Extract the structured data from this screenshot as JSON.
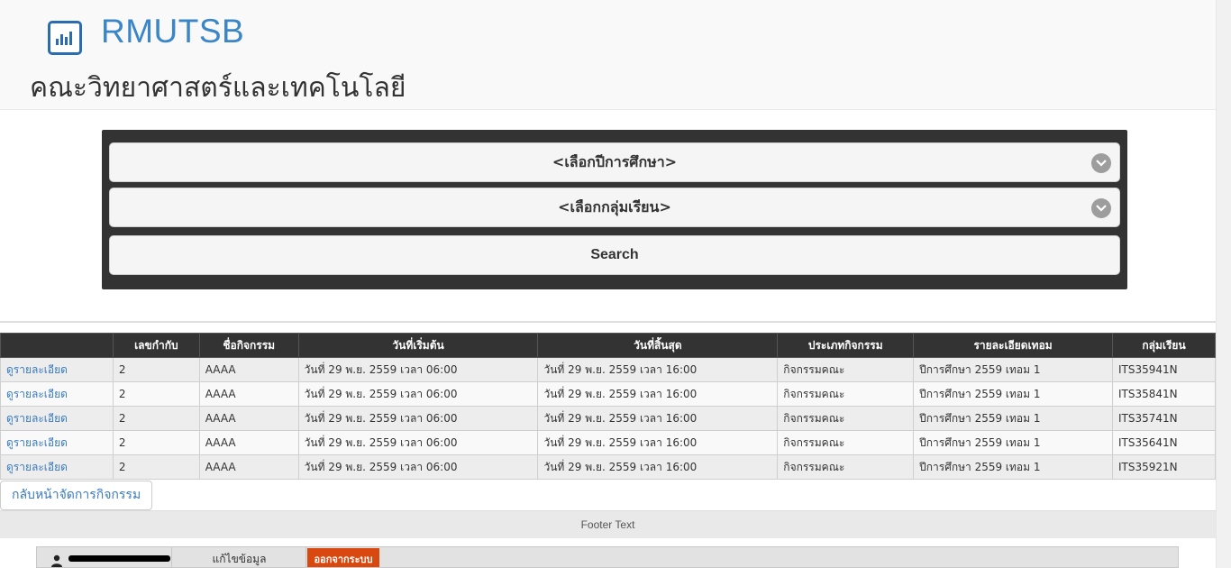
{
  "header": {
    "brand": "RMUTSB",
    "faculty": "คณะวิทยาศาสตร์และเทคโนโลยี",
    "logo_icon": "bar-chart-icon"
  },
  "filters": {
    "year_select": "<เลือกปีการศึกษา>",
    "group_select": "<เลือกกลุ่มเรียน>",
    "search_label": "Search"
  },
  "table": {
    "columns": [
      "",
      "เลขกำกับ",
      "ชื่อกิจกรรม",
      "วันที่เริ่มต้น",
      "วันที่สิ้นสุด",
      "ประเภทกิจกรรม",
      "รายละเอียดเทอม",
      "กลุ่มเรียน"
    ],
    "rows": [
      [
        "ดูรายละเอียด",
        "2",
        "AAAA",
        "วันที่ 29 พ.ย. 2559 เวลา 06:00",
        "วันที่ 29 พ.ย. 2559 เวลา 16:00",
        "กิจกรรมคณะ",
        "ปีการศึกษา 2559 เทอม 1",
        "ITS35941N"
      ],
      [
        "ดูรายละเอียด",
        "2",
        "AAAA",
        "วันที่ 29 พ.ย. 2559 เวลา 06:00",
        "วันที่ 29 พ.ย. 2559 เวลา 16:00",
        "กิจกรรมคณะ",
        "ปีการศึกษา 2559 เทอม 1",
        "ITS35841N"
      ],
      [
        "ดูรายละเอียด",
        "2",
        "AAAA",
        "วันที่ 29 พ.ย. 2559 เวลา 06:00",
        "วันที่ 29 พ.ย. 2559 เวลา 16:00",
        "กิจกรรมคณะ",
        "ปีการศึกษา 2559 เทอม 1",
        "ITS35741N"
      ],
      [
        "ดูรายละเอียด",
        "2",
        "AAAA",
        "วันที่ 29 พ.ย. 2559 เวลา 06:00",
        "วันที่ 29 พ.ย. 2559 เวลา 16:00",
        "กิจกรรมคณะ",
        "ปีการศึกษา 2559 เทอม 1",
        "ITS35641N"
      ],
      [
        "ดูรายละเอียด",
        "2",
        "AAAA",
        "วันที่ 29 พ.ย. 2559 เวลา 06:00",
        "วันที่ 29 พ.ย. 2559 เวลา 16:00",
        "กิจกรรมคณะ",
        "ปีการศึกษา 2559 เทอม 1",
        "ITS35921N"
      ]
    ]
  },
  "back_button": "กลับหน้าจัดการกิจกรรม",
  "footer_text": "Footer Text",
  "user_bar": {
    "edit_label": "แก้ไขข้อมูล",
    "logout_label": "ออกจากระบบ",
    "logout_color": "#d9480f"
  }
}
